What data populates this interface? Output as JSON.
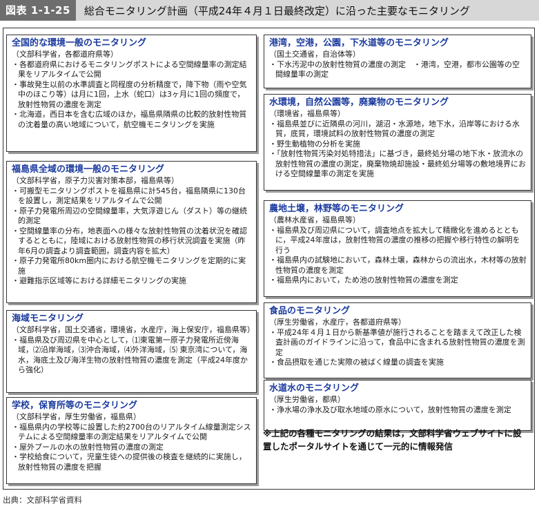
{
  "header": {
    "figure_label": "図表 1-1-25",
    "title": "総合モニタリング計画（平成24年４月１日最終改定）に沿った主要なモニタリング"
  },
  "boxes": {
    "national": {
      "title": "全国的な環境一般のモニタリング",
      "org": "（文部科学省，各都道府県等）",
      "items": [
        "各都道府県におけるモニタリングポストによる空間線量率の測定結果をリアルタイムで公開",
        "事故発生以前の水準調査と同程度の分析精度で，降下物（雨や空気中のほこり等）は月に1回，上水（蛇口）は3ヶ月に1回の頻度で，放射性物質の濃度を測定",
        "北海道，西日本を含む広域のほか，福島県隣県の比較的放射性物質の沈着量の高い地域について，航空機モニタリングを実施"
      ]
    },
    "fukushima": {
      "title": "福島県全域の環境一般のモニタリング",
      "org": "（文部科学省，原子力災害対策本部，福島県等）",
      "items": [
        "可搬型モニタリングポストを福島県に計545台，福島隣県に130台を設置し，測定結果をリアルタイムで公開",
        "原子力発電所周辺の空間線量率，大気浮遊じん（ダスト）等の継続的測定",
        "空間線量率の分布，地表面への様々な放射性物質の沈着状況を確認するとともに，陸域における放射性物質の移行状況調査を実施（昨年6月の調査より調査範囲，調査内容を拡大）",
        "原子力発電所80km圏内における航空機モニタリングを定期的に実施",
        "避難指示区域等における詳細モニタリングの実施"
      ]
    },
    "marine": {
      "title": "海域モニタリング",
      "org": "（文部科学省，国土交通省，環境省，水産庁，海上保安庁，福島県等）",
      "items": [
        "福島県及び周辺県を中心として，⑴東電第一原子力発電所近傍海域，⑵沿岸海域，⑶沖合海域，⑷外洋海域，⑸ 東京湾について，海水，海底土及び海洋生物の放射性物質の濃度を測定（平成24年度から強化）"
      ]
    },
    "schools": {
      "title": "学校，保育所等のモニタリング",
      "org": "（文部科学省，厚生労働省，福島県）",
      "items": [
        "福島県内の学校等に設置した約2700台のリアルタイム線量測定システムによる空間線量率の測定結果をリアルタイムで公開",
        "屋外プールの水の放射性物質の濃度の測定",
        "学校給食について，児童生徒への提供後の検査を継続的に実施し，放射性物質の濃度を把握"
      ]
    },
    "ports": {
      "title": "港湾，空港，公園，下水道等のモニタリング",
      "org": "（国土交通省，自治体等）",
      "items": [
        "下水汚泥中の放射性物質の濃度の測定　・港湾，空港，都市公園等の空間線量率の測定"
      ]
    },
    "water_env": {
      "title": "水環境，自然公園等，廃棄物のモニタリング",
      "org": "（環境省，福島県等）",
      "items": [
        "福島県並びに近隣県の河川，湖沼・水源地，地下水，沿岸等における水質，底質，環境試料の放射性物質の濃度の測定",
        "野生動植物の分析を実施",
        "「放射性物質汚染対処特措法」に基づき，最終処分場の地下水・放流水の放射性物質の濃度の測定，廃棄物焼却施設・最終処分場等の敷地境界における空間線量率の測定を実施"
      ]
    },
    "agri": {
      "title": "農地土壌，林野等のモニタリング",
      "org": "（農林水産省，福島県等）",
      "items": [
        "福島県及び周辺県について，調査地点を拡大して精緻化を進めるとともに，平成24年度は，放射性物質の濃度の推移の把握や移行特性の解明を行う",
        "福島県内の試験地において，森林土壌，森林からの流出水，木材等の放射性物質の濃度を測定",
        "福島県内において，ため池の放射性物質の濃度を測定"
      ]
    },
    "food": {
      "title": "食品のモニタリング",
      "org": "（厚生労働省，水産庁，各都道府県等）",
      "items": [
        "平成24年４月１日から新基準値が施行されることを踏まえて改正した検査計画のガイドラインに沿って，食品中に含まれる放射性物質の濃度を測定",
        "食品摂取を通じた実際の被ばく線量の調査を実施"
      ]
    },
    "tapwater": {
      "title": "水道水のモニタリング",
      "org": "（厚生労働省，都県）",
      "items": [
        "浄水場の浄水及び取水地域の原水について，放射性物質の濃度を測定"
      ]
    }
  },
  "note": "※上記の各種モニタリングの結果は，文部科学省ウェブサイトに設置したポータルサイトを通じて一元的に情報発信",
  "source": "出典：文部科学省資料"
}
